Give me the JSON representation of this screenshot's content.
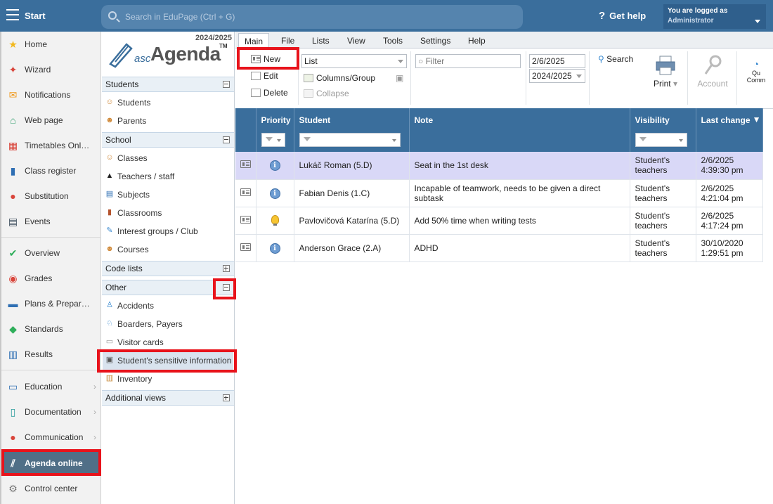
{
  "topbar": {
    "title": "Start",
    "search_placeholder": "Search in EduPage (Ctrl + G)",
    "help_label": "Get help",
    "logged_label": "You are logged as",
    "logged_user": "Administrator"
  },
  "leftnav": {
    "items": [
      {
        "label": "Home",
        "icon": "star-icon"
      },
      {
        "label": "Wizard",
        "icon": "wand-icon"
      },
      {
        "label": "Notifications",
        "icon": "envelope-icon"
      },
      {
        "label": "Web page",
        "icon": "house-icon"
      },
      {
        "label": "Timetables Onl…",
        "icon": "timetable-icon"
      },
      {
        "label": "Class register",
        "icon": "book-icon"
      },
      {
        "label": "Substitution",
        "icon": "person-icon"
      },
      {
        "label": "Events",
        "icon": "calendar-icon"
      },
      {
        "label": "Overview",
        "icon": "check-circle-icon"
      },
      {
        "label": "Grades",
        "icon": "grades-icon"
      },
      {
        "label": "Plans & Prepar…",
        "icon": "briefcase-icon"
      },
      {
        "label": "Standards",
        "icon": "shield-check-icon"
      },
      {
        "label": "Results",
        "icon": "bar-chart-icon"
      },
      {
        "label": "Education",
        "icon": "open-book-icon"
      },
      {
        "label": "Documentation",
        "icon": "document-icon"
      },
      {
        "label": "Communication",
        "icon": "chat-icon"
      },
      {
        "label": "Agenda online",
        "icon": "agenda-icon"
      },
      {
        "label": "Control center",
        "icon": "gear-icon"
      }
    ]
  },
  "panel": {
    "year": "2024/2025",
    "logo_prefix": "asc",
    "logo_name": "Agenda",
    "logo_tm": "TM",
    "sections": {
      "students": "Students",
      "school": "School",
      "code_lists": "Code lists",
      "other": "Other",
      "additional": "Additional views"
    },
    "students_items": [
      "Students",
      "Parents"
    ],
    "school_items": [
      "Classes",
      "Teachers / staff",
      "Subjects",
      "Classrooms",
      "Interest groups / Club",
      "Courses"
    ],
    "other_items": [
      "Accidents",
      "Boarders, Payers",
      "Visitor cards",
      "Student's sensitive information",
      "Inventory"
    ]
  },
  "menubar": {
    "items": [
      "Main",
      "File",
      "Lists",
      "View",
      "Tools",
      "Settings",
      "Help"
    ]
  },
  "toolbar": {
    "new_label": "New",
    "edit_label": "Edit",
    "delete_label": "Delete",
    "view_select": "List",
    "columns_label": "Columns/Group",
    "collapse_label": "Collapse",
    "filter_placeholder": "Filter",
    "date_value": "2/6/2025",
    "year_value": "2024/2025",
    "search_label": "Search",
    "print_label": "Print",
    "account_label": "Account",
    "cut_label_1": "Qu",
    "cut_label_2": "Comm"
  },
  "grid": {
    "columns": [
      "Priority",
      "Student",
      "Note",
      "Visibility",
      "Last change"
    ],
    "rows": [
      {
        "priority": "info",
        "student": "Lukáč Roman (5.D)",
        "note": "Seat in the 1st desk",
        "vis1": "Student's",
        "vis2": "teachers",
        "date": "2/6/2025",
        "time": "4:39:30 pm"
      },
      {
        "priority": "info",
        "student": "Fabian Denis (1.C)",
        "note": "Incapable of teamwork, needs to be given a direct subtask",
        "vis1": "Student's",
        "vis2": "teachers",
        "date": "2/6/2025",
        "time": "4:21:04 pm"
      },
      {
        "priority": "bulb",
        "student": "Pavlovičová Katarína (5.D)",
        "note": "Add 50% time when writing tests",
        "vis1": "Student's",
        "vis2": "teachers",
        "date": "2/6/2025",
        "time": "4:17:24 pm"
      },
      {
        "priority": "info",
        "student": "Anderson Grace (2.A)",
        "note": "ADHD",
        "vis1": "Student's",
        "vis2": "teachers",
        "date": "30/10/2020",
        "time": "1:29:51 pm"
      }
    ]
  },
  "colors": {
    "header_blue": "#3a6e9c",
    "highlight_red": "#e8131b",
    "selected_row": "#d9d8f7",
    "active_nav": "#506f87"
  }
}
